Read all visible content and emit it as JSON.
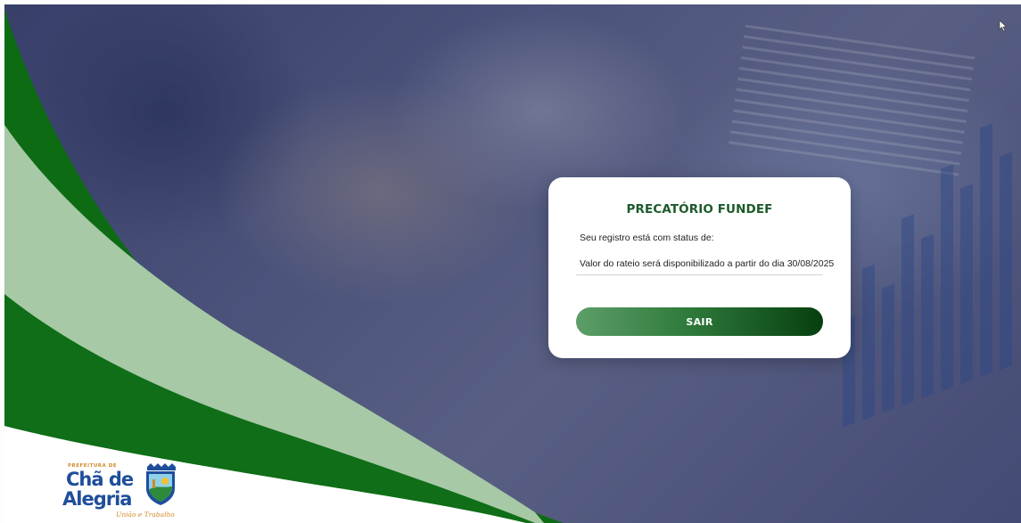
{
  "card": {
    "title": "PRECATÓRIO FUNDEF",
    "status_label": "Seu registro está com status de:",
    "status_value": "Valor do rateio será disponibilizado a partir do dia 30/08/2025",
    "exit_label": "SAIR"
  },
  "logo": {
    "prefix": "PREFEITURA DE",
    "name_line1": "Chã de",
    "name_line2": "Alegria",
    "slogan": "União e Trabalho"
  },
  "colors": {
    "brand_green": "#1d5a2a",
    "swoosh_dark_green": "#0d6b14",
    "swoosh_light_green": "#a7c9a6",
    "logo_blue": "#1f4e9b",
    "logo_orange": "#d08a2a"
  },
  "icons": {
    "cursor": "mouse-pointer-icon",
    "shield": "municipal-shield-icon"
  }
}
